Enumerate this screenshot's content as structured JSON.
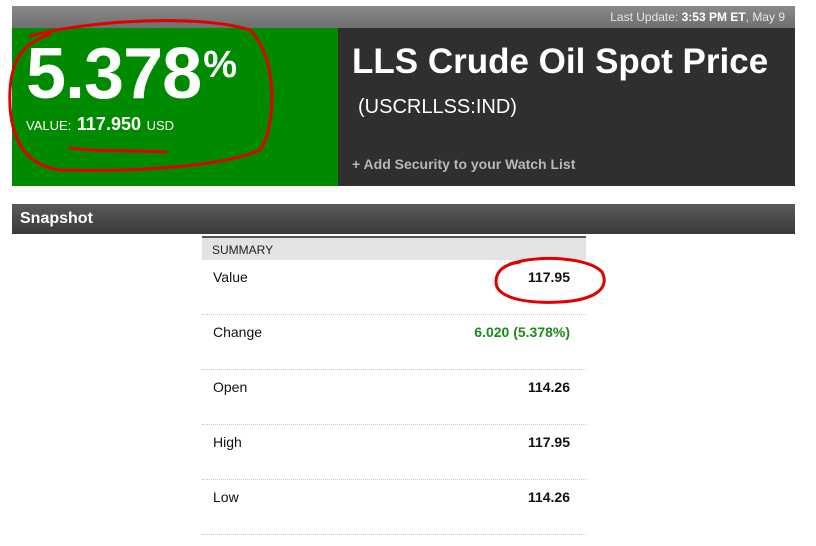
{
  "topbar": {
    "label": "Last Update:",
    "time": "3:53 PM ET",
    "date": "May 9"
  },
  "hero": {
    "percent": "5.378",
    "percent_symbol": "%",
    "value_label": "VALUE:",
    "value": "117.950",
    "currency": "USD",
    "title": "LLS Crude Oil Spot Price",
    "ticker": "(USCRLLSS:IND)",
    "watch_link": "+ Add Security to your Watch List"
  },
  "snapshot": {
    "heading": "Snapshot",
    "summary_heading": "SUMMARY",
    "rows": [
      {
        "label": "Value",
        "value": "117.95"
      },
      {
        "label": "Change",
        "value": "6.020 (5.378%)"
      },
      {
        "label": "Open",
        "value": "114.26"
      },
      {
        "label": "High",
        "value": "117.95"
      },
      {
        "label": "Low",
        "value": "114.26"
      }
    ]
  },
  "colors": {
    "positive_green": "#008a00",
    "change_green": "#1a8a1a",
    "annotation_red": "#e00000"
  }
}
